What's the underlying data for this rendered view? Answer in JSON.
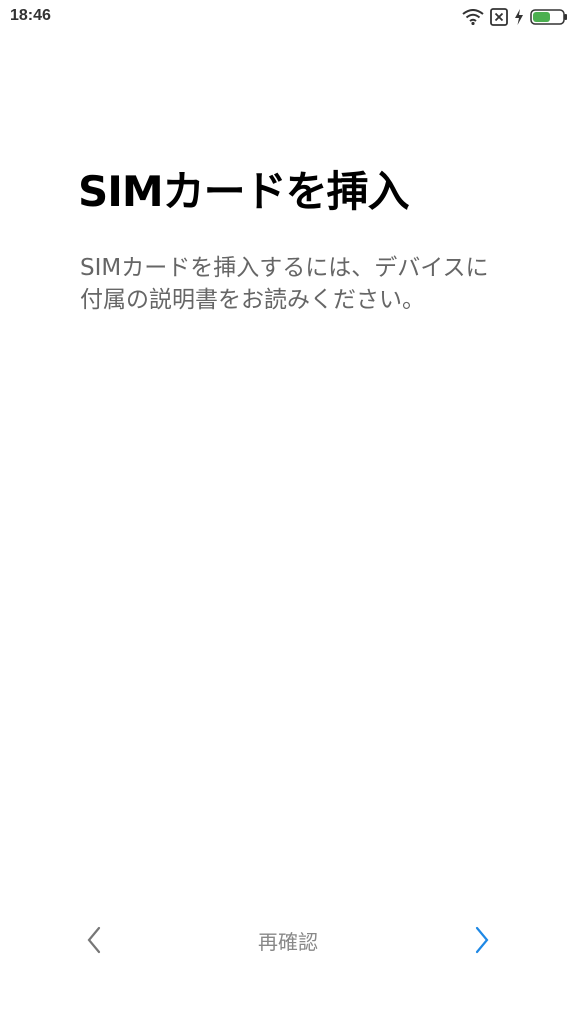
{
  "status_bar": {
    "time": "18:46",
    "icons": [
      "wifi-icon",
      "sim-off-icon",
      "charge-icon",
      "battery-icon"
    ],
    "battery_color": "#4caf50"
  },
  "main": {
    "title": "SIMカードを挿入",
    "description": "SIMカードを挿入するには、デバイスに付属の説明書をお読みください。"
  },
  "bottom_nav": {
    "center_label": "再確認",
    "prev_color": "#777777",
    "next_color": "#1e88e5"
  }
}
